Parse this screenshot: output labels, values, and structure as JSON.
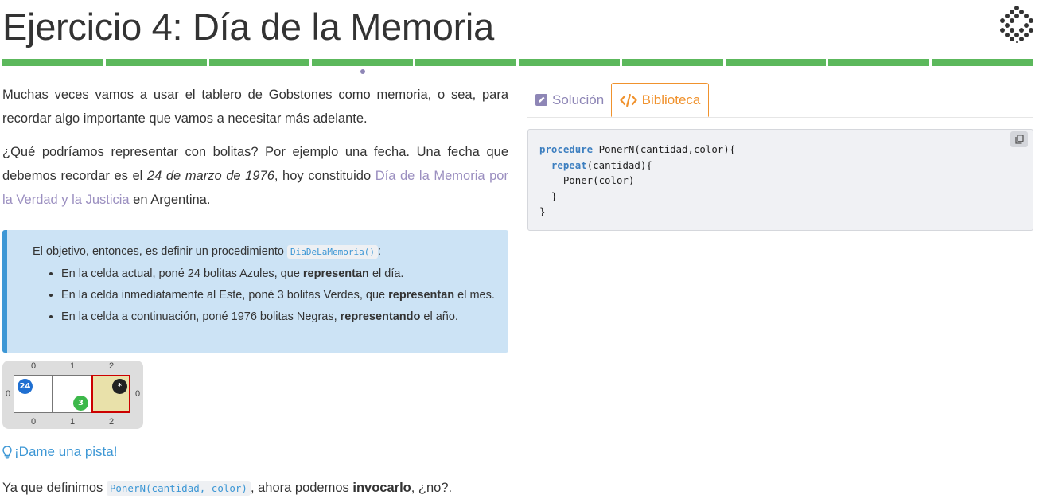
{
  "header": {
    "title": "Ejercicio 4: Día de la Memoria",
    "logo_icon": "gobstones-logo-icon"
  },
  "progress": {
    "segments": 10,
    "completed": 10,
    "current_index": 4,
    "color": "#5cb85c"
  },
  "content": {
    "p1": "Muchas veces vamos a usar el tablero de Gobstones como memoria, o sea, para recordar algo importante que vamos a necesitar más adelante.",
    "p2_a": "¿Qué podríamos representar con bolitas? Por ejemplo una fecha. Una fecha que debemos recordar es el ",
    "p2_date": "24 de marzo de 1976",
    "p2_b": ", hoy constituido ",
    "p2_link": "Día de la Memoria por la Verdad y la Justicia",
    "p2_c": " en Argentina."
  },
  "callout": {
    "intro_a": "El objetivo, entonces, es definir un procedimiento ",
    "intro_code": "DiaDeLaMemoria()",
    "intro_b": ":",
    "items": [
      {
        "a": "En la celda actual, poné 24 bolitas Azules, que ",
        "b": "representan",
        "c": " el día."
      },
      {
        "a": "En la celda inmediatamente al Este, poné 3 bolitas Verdes, que ",
        "b": "representan",
        "c": " el mes."
      },
      {
        "a": "En la celda a continuación, poné 1976 bolitas Negras, ",
        "b": "representando",
        "c": " el año."
      }
    ]
  },
  "board": {
    "columns": [
      "0",
      "1",
      "2"
    ],
    "rows": [
      "0"
    ],
    "cells": [
      {
        "ball_color": "blue",
        "count": "24"
      },
      {
        "ball_color": "green",
        "count": "3"
      },
      {
        "ball_color": "black",
        "count": "*",
        "current": true
      }
    ],
    "colors": {
      "blue": "#1f6fd1",
      "green": "#3cb84a",
      "black": "#222222",
      "current_bg": "#e9e1aa",
      "current_border": "#cc0000"
    }
  },
  "hint": {
    "icon": "lightbulb-icon",
    "label": "¡Dame una pista!"
  },
  "bottom": {
    "a": "Ya que definimos ",
    "code": "PonerN(cantidad, color)",
    "b": ", ahora podemos ",
    "bold": "invocarlo",
    "c": ", ¿no?."
  },
  "tabs": [
    {
      "icon": "edit-icon",
      "label": "Solución",
      "active": false
    },
    {
      "icon": "code-icon",
      "label": "Biblioteca",
      "active": true
    }
  ],
  "code": {
    "line1_kw": "procedure",
    "line1_rest": " PonerN(cantidad,color){",
    "line2_indent": "  ",
    "line2_kw": "repeat",
    "line2_rest": "(cantidad){",
    "line3": "    Poner(color)",
    "line4": "  }",
    "line5": "}",
    "copy_icon": "copy-icon"
  },
  "colors": {
    "accent_purple": "#8e86b6",
    "accent_orange": "#f0922d",
    "link_blue": "#3d97d5",
    "callout_bg": "#cce3f5"
  }
}
